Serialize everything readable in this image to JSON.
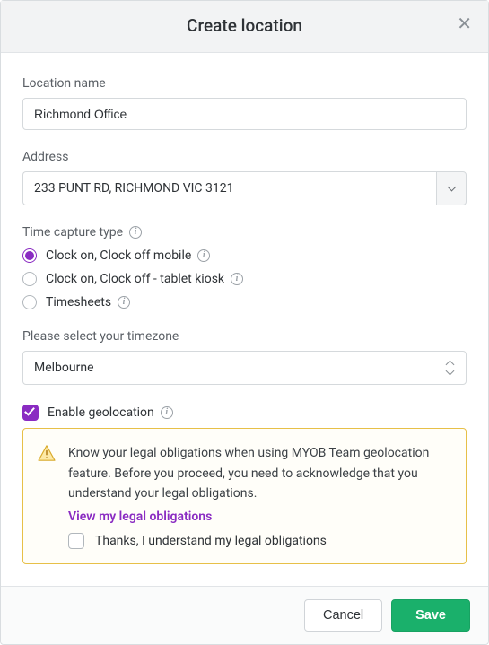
{
  "modal": {
    "title": "Create location"
  },
  "locationName": {
    "label": "Location name",
    "value": "Richmond Office"
  },
  "address": {
    "label": "Address",
    "value": "233 PUNT RD, RICHMOND VIC 3121"
  },
  "timeCapture": {
    "label": "Time capture type",
    "options": [
      {
        "label": "Clock on, Clock off mobile",
        "selected": true
      },
      {
        "label": "Clock on, Clock off - tablet kiosk",
        "selected": false
      },
      {
        "label": "Timesheets",
        "selected": false
      }
    ]
  },
  "timezone": {
    "label": "Please select your timezone",
    "value": "Melbourne"
  },
  "geolocation": {
    "enable_label": "Enable geolocation",
    "enabled": true,
    "notice": "Know your legal obligations when using MYOB Team geolocation feature. Before you proceed, you need to acknowledge that you understand your legal obligations.",
    "link_label": "View my legal obligations",
    "ack_label": "Thanks, I understand my legal obligations",
    "ack_checked": false
  },
  "footer": {
    "cancel": "Cancel",
    "save": "Save"
  }
}
